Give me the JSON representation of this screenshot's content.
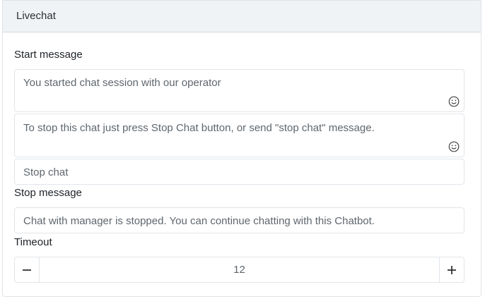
{
  "card": {
    "title": "Livechat"
  },
  "start_message": {
    "label": "Start message",
    "value": "You started chat session with our operator"
  },
  "stop_instruction": {
    "value": "To stop this chat just press Stop Chat button, or send \"stop chat\" message."
  },
  "stop_keyword": {
    "value": "Stop chat"
  },
  "stop_message": {
    "label": "Stop message",
    "value": "Chat with manager is stopped. You can continue chatting with this Chatbot."
  },
  "timeout": {
    "label": "Timeout",
    "value": "12"
  },
  "icons": {
    "emoji": "smiley-icon",
    "decrement": "minus-icon",
    "increment": "plus-icon"
  }
}
